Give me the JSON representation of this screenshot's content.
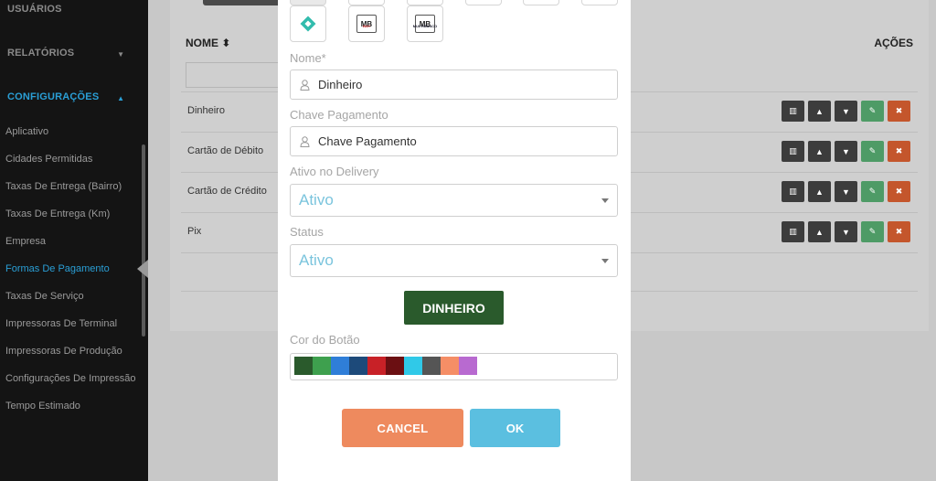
{
  "sidebar": {
    "sections": [
      {
        "label": "USUÁRIOS"
      },
      {
        "label": "RELATÓRIOS",
        "caret": "▼"
      },
      {
        "label": "CONFIGURAÇÕES",
        "caret": "▲"
      }
    ],
    "items": [
      {
        "label": "Aplicativo"
      },
      {
        "label": "Cidades Permitidas"
      },
      {
        "label": "Taxas De Entrega (Bairro)"
      },
      {
        "label": "Taxas De Entrega (Km)"
      },
      {
        "label": "Empresa"
      },
      {
        "label": "Formas De Pagamento"
      },
      {
        "label": "Taxas De Serviço"
      },
      {
        "label": "Impressoras De Terminal"
      },
      {
        "label": "Impressoras De Produção"
      },
      {
        "label": "Configurações De Impressão"
      },
      {
        "label": "Tempo Estimado"
      }
    ]
  },
  "table": {
    "col_name": "NOME ⬍",
    "col_actions": "AÇÕES",
    "rows": [
      {
        "name": "Dinheiro"
      },
      {
        "name": "Cartão de Débito"
      },
      {
        "name": "Cartão de Crédito"
      },
      {
        "name": "Pix"
      }
    ]
  },
  "modal": {
    "payment_icons": [
      {
        "name": "pix-icon",
        "label": ""
      },
      {
        "name": "mbway-icon",
        "label": "MB",
        "sub": "WAY"
      },
      {
        "name": "multibanco-icon",
        "label": "MB",
        "sub": "MULTIBANCO"
      }
    ],
    "nome_label": "Nome*",
    "nome_value": "Dinheiro",
    "chave_label": "Chave Pagamento",
    "chave_placeholder": "Chave Pagamento",
    "delivery_label": "Ativo no Delivery",
    "delivery_value": "Ativo",
    "status_label": "Status",
    "status_value": "Ativo",
    "preview_label": "DINHEIRO",
    "color_label": "Cor do Botão",
    "colors": [
      "#2a5a2c",
      "#3ea04e",
      "#2f7ed8",
      "#1d4a7a",
      "#c82127",
      "#6b0f12",
      "#30c9e8",
      "#555555",
      "#f58e66",
      "#b86ad0"
    ],
    "cancel_label": "CANCEL",
    "ok_label": "OK"
  }
}
